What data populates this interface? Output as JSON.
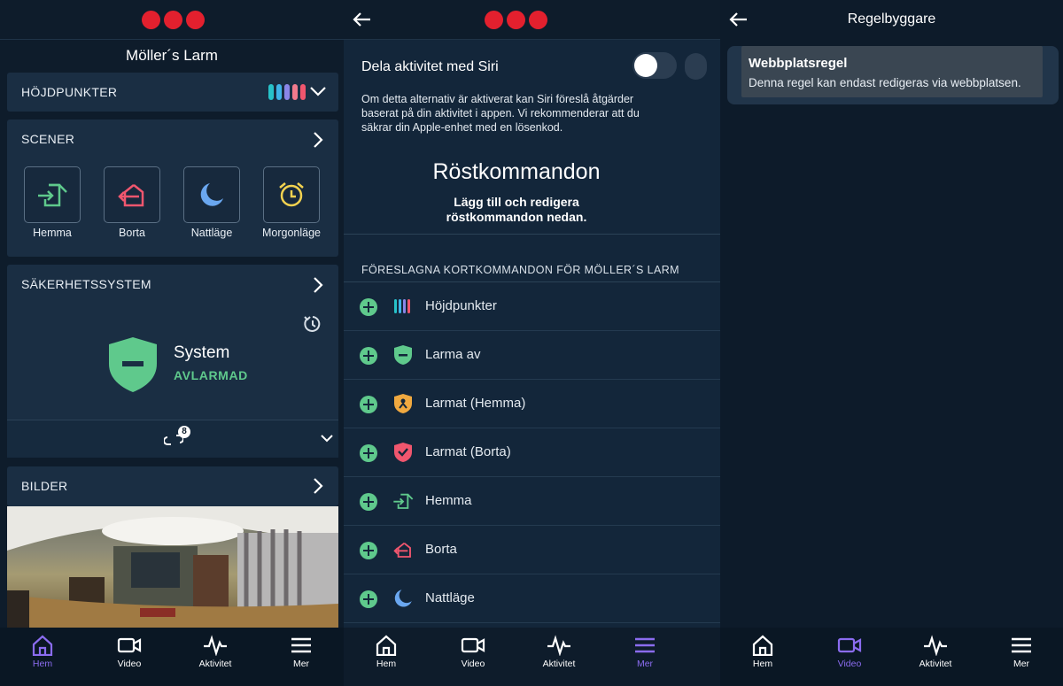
{
  "panel_home": {
    "title": "Möller´s Larm",
    "highlights": {
      "label": "HÖJDPUNKTER",
      "bar_colors": [
        "#27c2c9",
        "#3fb4e8",
        "#8a86e8",
        "#f07a8c",
        "#f0566e"
      ]
    },
    "scenes": {
      "label": "SCENER",
      "items": [
        {
          "label": "Hemma",
          "icon": "home-arrive-icon"
        },
        {
          "label": "Borta",
          "icon": "home-leave-icon"
        },
        {
          "label": "Nattläge",
          "icon": "moon-icon"
        },
        {
          "label": "Morgonläge",
          "icon": "alarm-clock-icon"
        }
      ]
    },
    "security": {
      "label": "SÄKERHETSSYSTEM",
      "system_name": "System",
      "state": "AVLARMAD",
      "badge_count": "8"
    },
    "images": {
      "label": "BILDER"
    }
  },
  "panel_siri": {
    "toggle_label": "Dela aktivitet med Siri",
    "toggle_on": false,
    "description": "Om detta alternativ är aktiverat kan Siri föreslå åtgärder baserat på din aktivitet i appen. Vi rekommenderar att du säkrar din Apple-enhet med en lösenkod.",
    "voice_title": "Röstkommandon",
    "voice_subtitle": "Lägg till och redigera röstkommandon nedan.",
    "section_caption": "FÖRESLAGNA KORTKOMMANDON FÖR MÖLLER´S LARM",
    "shortcuts": [
      {
        "label": "Höjdpunkter",
        "icon": "highlights-icon"
      },
      {
        "label": "Larma av",
        "icon": "shield-disarm-icon"
      },
      {
        "label": "Larmat (Hemma)",
        "icon": "shield-home-icon"
      },
      {
        "label": "Larmat (Borta)",
        "icon": "shield-away-icon"
      },
      {
        "label": "Hemma",
        "icon": "home-arrive-icon"
      },
      {
        "label": "Borta",
        "icon": "home-leave-icon"
      },
      {
        "label": "Nattläge",
        "icon": "moon-icon"
      }
    ]
  },
  "panel_rules": {
    "title": "Regelbyggare",
    "rule_title": "Webbplatsregel",
    "rule_desc": "Denna regel kan endast redigeras via webbplatsen."
  },
  "tabs": [
    {
      "label": "Hem",
      "icon": "home-icon"
    },
    {
      "label": "Video",
      "icon": "video-icon"
    },
    {
      "label": "Aktivitet",
      "icon": "activity-icon"
    },
    {
      "label": "Mer",
      "icon": "menu-icon"
    }
  ],
  "colors": {
    "accent": "#8b6cf0",
    "green": "#5fc98c",
    "red": "#e3202e",
    "card": "#1a2e43"
  }
}
